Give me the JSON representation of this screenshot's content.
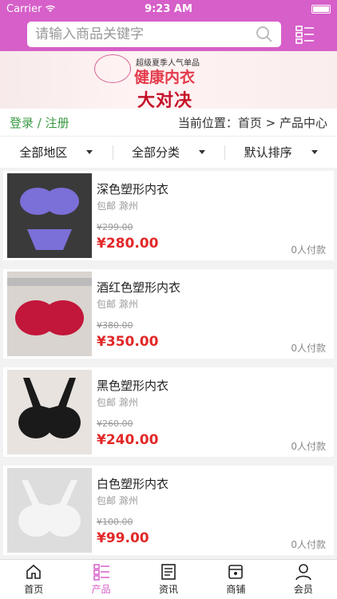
{
  "status": {
    "carrier": "Carrier",
    "time": "9:23 AM"
  },
  "search": {
    "placeholder": "请输入商品关键字"
  },
  "banner": {
    "tag": "超级夏季人气单品",
    "line1": "健康内衣",
    "line2": "大对决"
  },
  "location": {
    "login": "登录 / 注册",
    "breadcrumb": "当前位置：首页 > 产品中心"
  },
  "filters": [
    {
      "label": "全部地区"
    },
    {
      "label": "全部分类"
    },
    {
      "label": "默认排序"
    }
  ],
  "products": [
    {
      "title": "深色塑形内衣",
      "shipping": "包邮 滁州",
      "old_price": "¥299.00",
      "price": "¥280.00",
      "paid": "0人付款",
      "color": "#7b6fd8"
    },
    {
      "title": "酒红色塑形内衣",
      "shipping": "包邮 滁州",
      "old_price": "¥380.00",
      "price": "¥350.00",
      "paid": "0人付款",
      "color": "#c2163a"
    },
    {
      "title": "黑色塑形内衣",
      "shipping": "包邮 滁州",
      "old_price": "¥260.00",
      "price": "¥240.00",
      "paid": "0人付款",
      "color": "#1a1a1a"
    },
    {
      "title": "白色塑形内衣",
      "shipping": "包邮 滁州",
      "old_price": "¥100.00",
      "price": "¥99.00",
      "paid": "0人付款",
      "color": "#e6e6e6"
    }
  ],
  "tabs": [
    {
      "label": "首页",
      "icon": "home-icon"
    },
    {
      "label": "产品",
      "icon": "product-icon"
    },
    {
      "label": "资讯",
      "icon": "news-icon"
    },
    {
      "label": "商铺",
      "icon": "store-icon"
    },
    {
      "label": "会员",
      "icon": "user-icon"
    }
  ],
  "colors": {
    "brand": "#d65fc9",
    "price": "#e22828",
    "login": "#3a9a43"
  }
}
